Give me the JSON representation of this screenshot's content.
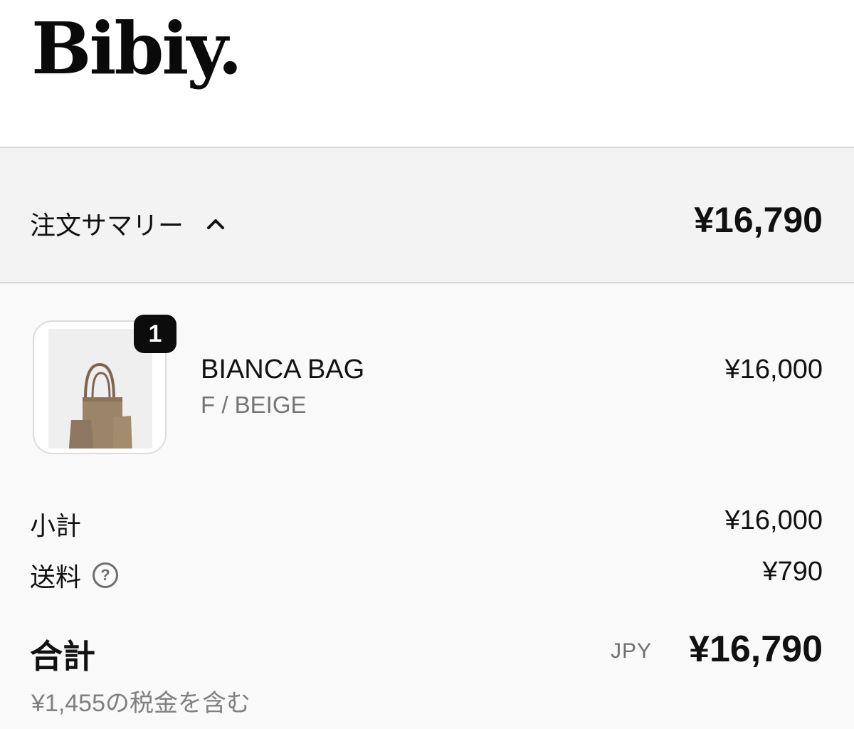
{
  "brand": {
    "logo_text": "Bibiy."
  },
  "order_summary": {
    "toggle_label": "注文サマリー",
    "toggle_icon": "chevron-up-icon",
    "total": "¥16,790"
  },
  "line_items": [
    {
      "name": "BIANCA BAG",
      "variant": "F / BEIGE",
      "price": "¥16,000",
      "quantity": "1",
      "image": "beige-tote-bag"
    }
  ],
  "totals": {
    "subtotal_label": "小計",
    "subtotal_value": "¥16,000",
    "shipping_label": "送料",
    "shipping_help_icon": "question-circle-icon",
    "shipping_value": "¥790",
    "total_label": "合計",
    "currency": "JPY",
    "total_value": "¥16,790",
    "tax_note": "¥1,455の税金を含む"
  },
  "colors": {
    "summary_bg": "#f3f3f3",
    "content_bg": "#f9f9f9",
    "product_tan": "#9c8468",
    "badge_bg": "#0c0c0c"
  }
}
